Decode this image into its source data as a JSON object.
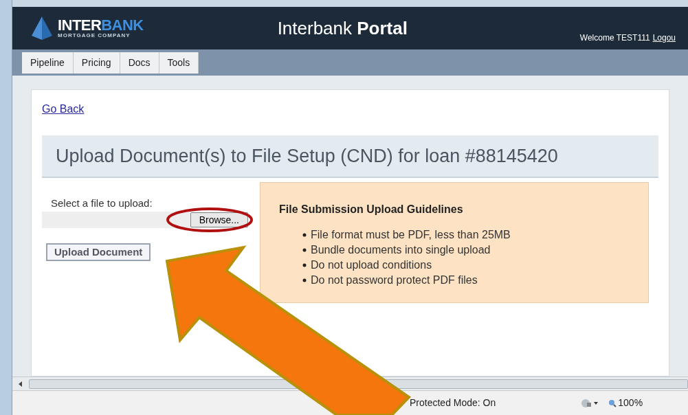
{
  "header": {
    "logo_main": "INTER",
    "logo_accent": "BANK",
    "logo_sub": "MORTGAGE COMPANY",
    "title": "Interbank **Portal**",
    "welcome": "Welcome TEST111",
    "logout": "Logou"
  },
  "tabs": [
    {
      "label": "Pipeline",
      "selected": false
    },
    {
      "label": "Pricing",
      "selected": false
    },
    {
      "label": "Docs",
      "selected": false
    },
    {
      "label": "Tools",
      "selected": false
    }
  ],
  "back_link": "Go Back",
  "page_title": "Upload Document(s) to File Setup (CND) for loan #88145420",
  "upload": {
    "label": "Select a file to upload:",
    "browse": "Browse...",
    "submit": "Upload Document"
  },
  "guidelines": {
    "title": "File Submission Upload Guidelines",
    "items": [
      "File format must be PDF, less than 25MB",
      "Bundle documents into single upload",
      "Do not upload conditions",
      "Do not password protect PDF files"
    ]
  },
  "status_bar": {
    "mode": "Protected Mode: On",
    "zoom": "100%"
  }
}
